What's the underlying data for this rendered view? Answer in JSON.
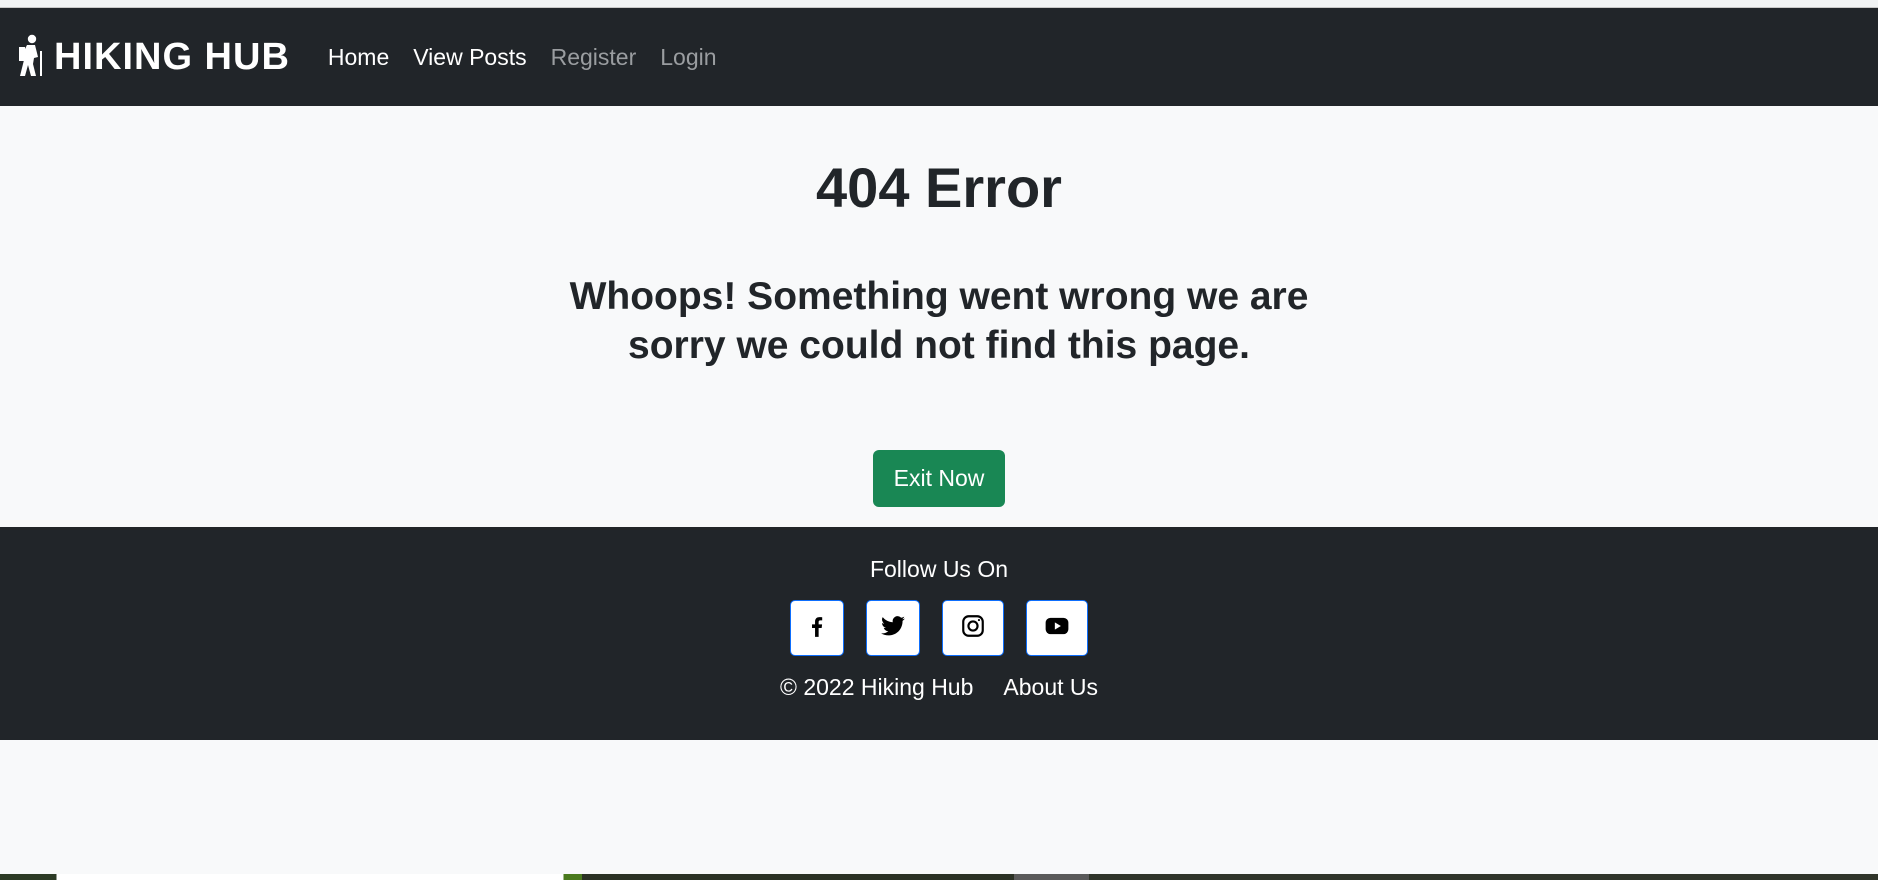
{
  "brand": {
    "name": "HIKING HUB",
    "icon": "hiker-icon"
  },
  "nav": {
    "items": [
      {
        "label": "Home",
        "state": "active"
      },
      {
        "label": "View Posts",
        "state": "active"
      },
      {
        "label": "Register",
        "state": "muted"
      },
      {
        "label": "Login",
        "state": "muted"
      }
    ]
  },
  "main": {
    "title": "404 Error",
    "message": "Whoops! Something went wrong we are sorry we could not find this page.",
    "exit_label": "Exit Now"
  },
  "footer": {
    "follow_label": "Follow Us On",
    "socials": [
      "facebook-icon",
      "twitter-icon",
      "instagram-icon",
      "youtube-icon"
    ],
    "copyright": "© 2022 Hiking Hub",
    "about_label": "About Us"
  },
  "colors": {
    "navbar_bg": "#212529",
    "page_bg": "#f8f9fa",
    "button_green": "#198754",
    "social_border": "#0d6efd"
  }
}
